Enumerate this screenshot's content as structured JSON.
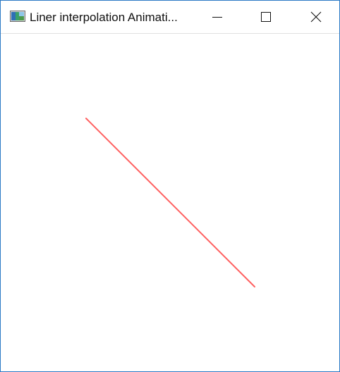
{
  "window": {
    "title": "Liner interpolation Animati...",
    "icon": "app-window-icon",
    "border_color": "#2b79c5"
  },
  "caption_buttons": {
    "minimize_icon": "minimize-icon",
    "maximize_icon": "maximize-icon",
    "close_icon": "close-icon"
  },
  "canvas": {
    "background": "#ffffff",
    "line_color": "#ff6060"
  }
}
